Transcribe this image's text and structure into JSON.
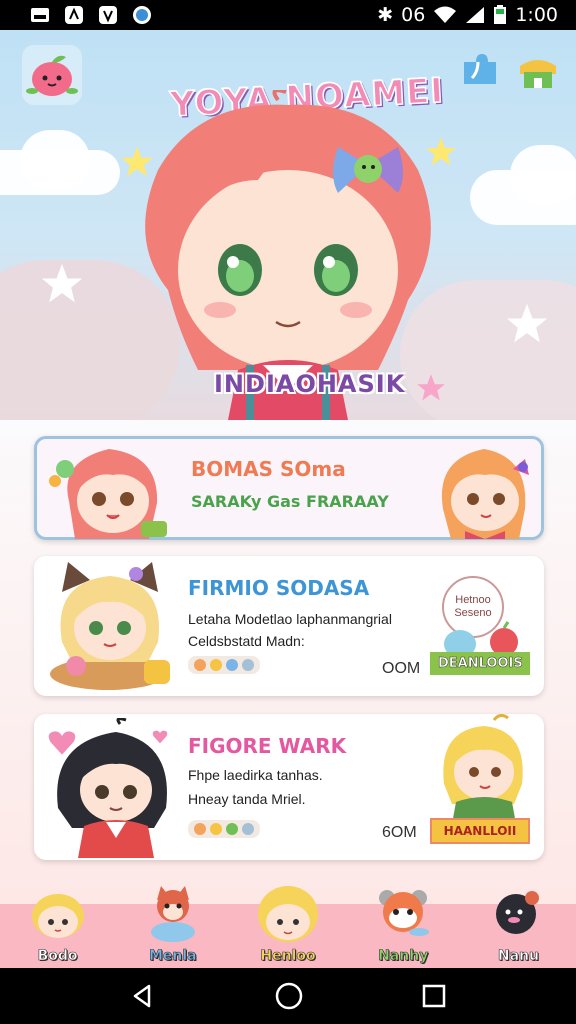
{
  "status_bar": {
    "network": "06",
    "time": "1:00"
  },
  "hero": {
    "app_title": "YOYA NOAMEI",
    "character_name": "INDIAOHASIK"
  },
  "cards": [
    {
      "title": "BOMAS SOma",
      "desc1": "SARAKy Gas FRARAAY",
      "desc2": "",
      "count": "",
      "ribbon": ""
    },
    {
      "title": "FIRMIO SODASA",
      "desc1": "Letaha Modetlao laphanmangrial",
      "desc2": "Celdsbstatd Madn:",
      "count": "OOM",
      "ribbon": "DEANLOOIS",
      "bubble": "Hetnoo Seseno"
    },
    {
      "title": "FIGORE WARK",
      "desc1": "Fhpe laedirka tanhas.",
      "desc2": "Hneay tanda Mriel.",
      "count": "6OM",
      "ribbon": "HAANLLOII"
    }
  ],
  "bottom_nav": [
    {
      "label": "Bodo"
    },
    {
      "label": "Menla"
    },
    {
      "label": "Henloo"
    },
    {
      "label": "Nanhy"
    },
    {
      "label": "Nanu"
    }
  ],
  "colors": {
    "accent_pink": "#f28bb6",
    "nav_bg": "#f9b8c2",
    "selected_border": "#9ec3df"
  },
  "icons": [
    "apple-mascot-icon",
    "puzzle-icon",
    "shop-icon",
    "back-icon",
    "home-icon",
    "recents-icon"
  ]
}
